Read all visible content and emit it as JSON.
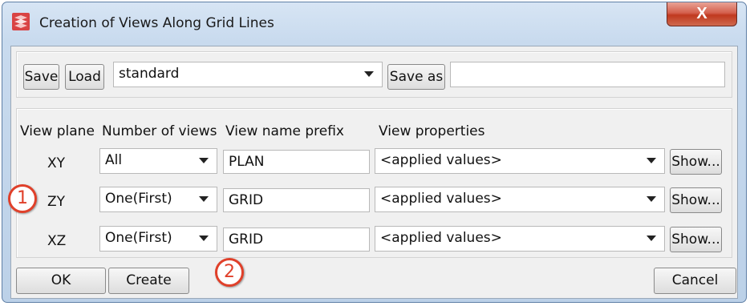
{
  "window": {
    "title": "Creation of Views Along Grid Lines",
    "close_label": "X"
  },
  "toolbar": {
    "save_label": "Save",
    "load_label": "Load",
    "preset_value": "standard",
    "save_as_label": "Save as",
    "save_as_value": ""
  },
  "table": {
    "headers": [
      "View plane",
      "Number of views",
      "View name prefix",
      "View properties"
    ],
    "rows": [
      {
        "plane": "XY",
        "count": "All",
        "prefix": "PLAN",
        "properties": "<applied values>",
        "show_label": "Show..."
      },
      {
        "plane": "ZY",
        "count": "One(First)",
        "prefix": "GRID",
        "properties": "<applied values>",
        "show_label": "Show..."
      },
      {
        "plane": "XZ",
        "count": "One(First)",
        "prefix": "GRID",
        "properties": "<applied values>",
        "show_label": "Show..."
      }
    ]
  },
  "footer": {
    "ok_label": "OK",
    "create_label": "Create",
    "cancel_label": "Cancel"
  },
  "callouts": [
    "1",
    "2"
  ],
  "colors": {
    "callout": "#e0402a",
    "close_button": "#c0391f",
    "frame": "#c8daee"
  }
}
